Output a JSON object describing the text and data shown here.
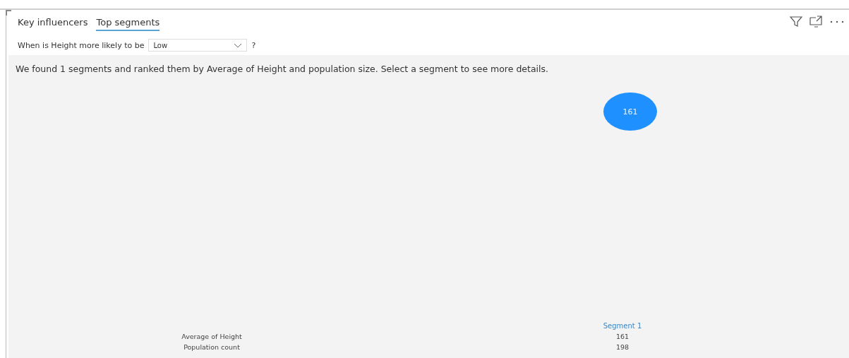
{
  "tabs": [
    {
      "label": "Key influencers",
      "selected": false
    },
    {
      "label": "Top segments",
      "selected": true
    }
  ],
  "filter": {
    "label": "When is Height more likely to be",
    "value": "Low",
    "help": "?"
  },
  "summary": "We found 1 segments and ranked them by Average of Height and population size. Select a segment to see more details.",
  "segments": [
    {
      "label": "161",
      "selected": false
    }
  ],
  "table": {
    "columns": [
      "Segment 1"
    ],
    "rows": [
      {
        "label": "Average of Height",
        "values": [
          "161"
        ]
      },
      {
        "label": "Population count",
        "values": [
          "198"
        ]
      }
    ]
  }
}
